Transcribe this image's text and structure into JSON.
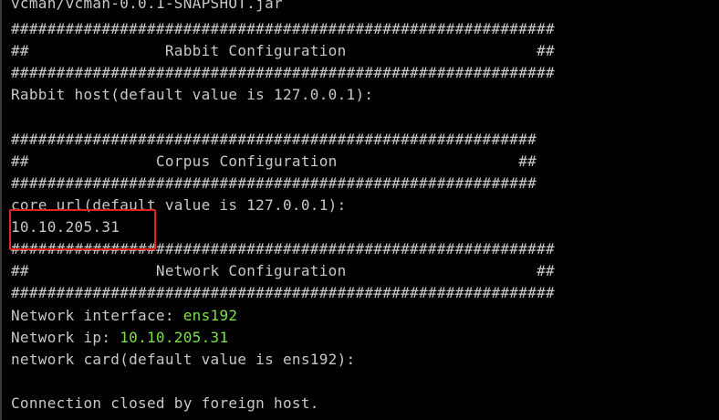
{
  "terminal": {
    "lines": {
      "l0": "vcman/vcman-0.0.1-SNAPSHOT.jar",
      "l1": "############################################################",
      "l2": "##               Rabbit Configuration                     ##",
      "l3": "############################################################",
      "l4": "Rabbit host(default value is 127.0.0.1):",
      "l5": "##########################################################",
      "l6": "##              Corpus Configuration                    ##",
      "l7": "##########################################################",
      "l8": "core url(default value is 127.0.0.1):",
      "l9": "10.10.205.31",
      "l10": "############################################################",
      "l11": "##              Network Configuration                     ##",
      "l12": "############################################################",
      "l13_label": "Network interface: ",
      "l13_value": "ens192",
      "l14_label": "Network ip: ",
      "l14_value": "10.10.205.31",
      "l15": "network card(default value is ens192):",
      "l16": "Connection closed by foreign host."
    }
  },
  "colors": {
    "background": "#000000",
    "text": "#c8c8c8",
    "highlight_value": "#7be04a",
    "annotation_box": "#e8231f"
  }
}
